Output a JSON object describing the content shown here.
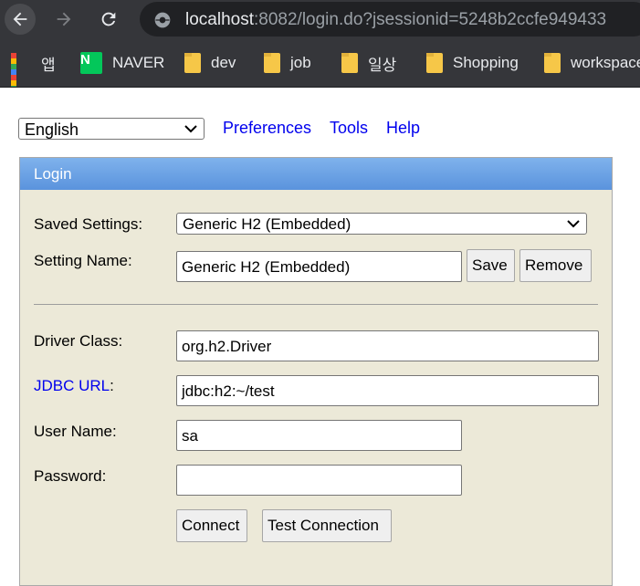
{
  "browser": {
    "url_host": "localhost",
    "url_rest": ":8082/login.do?jsessionid=5248b2ccfe949433",
    "bookmarks": [
      {
        "label": "앱",
        "icon": "apps-icon"
      },
      {
        "label": "NAVER",
        "icon": "naver-icon",
        "icon_text": "N"
      },
      {
        "label": "dev",
        "icon": "folder-icon"
      },
      {
        "label": "job",
        "icon": "folder-icon"
      },
      {
        "label": "일상",
        "icon": "folder-icon"
      },
      {
        "label": "Shopping",
        "icon": "folder-icon"
      },
      {
        "label": "workspace",
        "icon": "folder-icon"
      }
    ]
  },
  "top": {
    "language": "English",
    "links": [
      "Preferences",
      "Tools",
      "Help"
    ]
  },
  "login": {
    "title": "Login",
    "saved_settings_label": "Saved Settings:",
    "saved_settings_value": "Generic H2 (Embedded)",
    "setting_name_label": "Setting Name:",
    "setting_name_value": "Generic H2 (Embedded)",
    "save_button": "Save",
    "remove_button": "Remove",
    "driver_class_label": "Driver Class:",
    "driver_class_value": "org.h2.Driver",
    "jdbc_url_link": "JDBC URL",
    "jdbc_url_colon": ":",
    "jdbc_url_value": "jdbc:h2:~/test",
    "user_name_label": "User Name:",
    "user_name_value": "sa",
    "password_label": "Password:",
    "password_value": "",
    "connect_button": "Connect",
    "test_connection_button": "Test Connection"
  },
  "colors": {
    "header_gradient_top": "#7fb2ec",
    "header_gradient_bottom": "#5a93dd",
    "panel_bg": "#ece9d8",
    "link": "#0000ee"
  }
}
